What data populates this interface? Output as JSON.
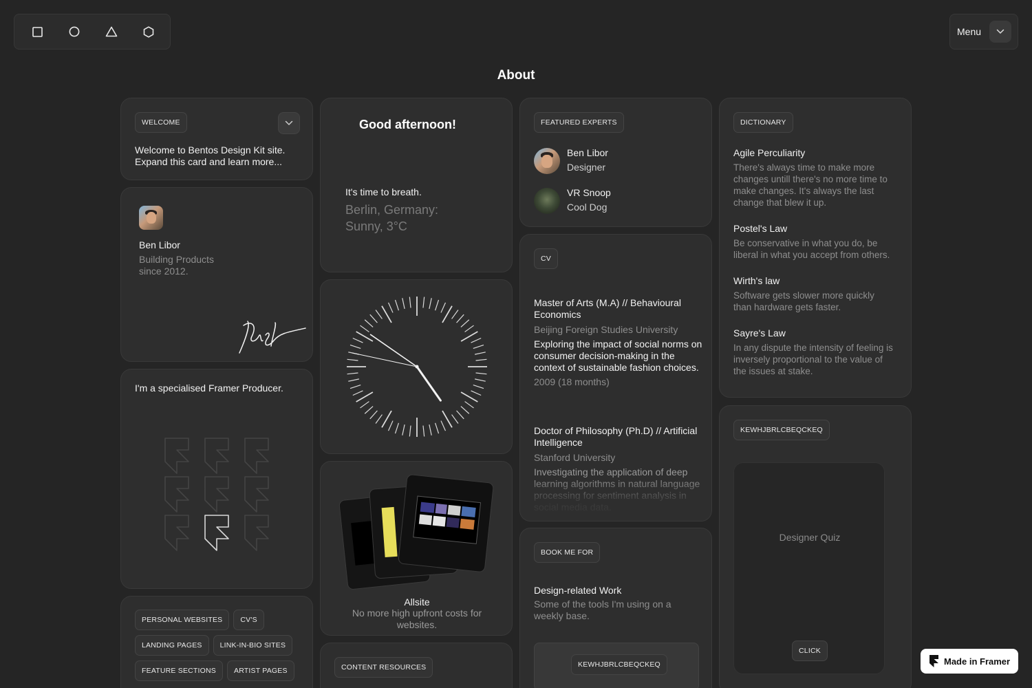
{
  "topbar": {
    "shapes": [
      "square-icon",
      "circle-icon",
      "triangle-icon",
      "hexagon-icon"
    ],
    "menu_label": "Menu"
  },
  "page": {
    "title": "About"
  },
  "welcome": {
    "tag": "WELCOME",
    "text": "Welcome to Bentos Design Kit site. Expand this card and learn more..."
  },
  "profile": {
    "name": "Ben Libor",
    "subtitle": "Building Products since 2012."
  },
  "greeting": {
    "title": "Good afternoon!",
    "line": "It's time to breath.",
    "weather": "Berlin, Germany: Sunny, 3°C"
  },
  "clock": {
    "hour": 4,
    "minute": 50,
    "second": 47
  },
  "experts": {
    "tag": "FEATURED EXPERTS",
    "items": [
      {
        "name": "Ben Libor",
        "role": "Designer"
      },
      {
        "name": "VR Snoop",
        "role": "Cool Dog"
      }
    ]
  },
  "dictionary": {
    "tag": "DICTIONARY",
    "entries": [
      {
        "term": "Agile Perculiarity",
        "definition": "There's always time to make more changes untill there's no more time to make changes. It's always the last change that blew it up."
      },
      {
        "term": "Postel's Law",
        "definition": "Be conservative in what you do, be liberal in what you accept from others."
      },
      {
        "term": "Wirth's law",
        "definition": "Software gets slower more quickly than hardware gets faster."
      },
      {
        "term": "Sayre's Law",
        "definition": "In any dispute the intensity of feeling is inversely proportional to the value of the issues at stake."
      }
    ]
  },
  "producer": {
    "text": "I'm a specialised Framer Producer."
  },
  "cv": {
    "tag": "CV",
    "items": [
      {
        "degree": "Master of Arts (M.A) // Behavioural Economics",
        "school": "Beijing Foreign Studies University",
        "description": "Exploring the impact of social norms on consumer decision-making in the context of sustainable fashion choices.",
        "period": "2009 (18 months)"
      },
      {
        "degree": "Doctor of Philosophy (Ph.D) // Artificial Intelligence",
        "school": "Stanford University",
        "description": "Investigating the application of deep learning algorithms in natural language processing for sentiment analysis in social media data."
      }
    ]
  },
  "allsite": {
    "title": "Allsite",
    "subtitle": "No more high upfront costs for websites."
  },
  "quiz": {
    "tag": "KEWHJBRLCBEQCKEQ",
    "title": "Designer Quiz",
    "button": "CLICK"
  },
  "book": {
    "tag": "BOOK ME FOR",
    "title": "Design-related Work",
    "subtitle": "Some of the tools I'm using on a weekly base.",
    "inner_tag": "KEWHJBRLCBEQCKEQ"
  },
  "services": {
    "rows": [
      [
        "PERSONAL WEBSITES",
        "CV'S"
      ],
      [
        "LANDING PAGES",
        "LINK-IN-BIO SITES"
      ],
      [
        "FEATURE SECTIONS",
        "ARTIST PAGES"
      ]
    ]
  },
  "content_resources": {
    "tag": "CONTENT RESOURCES"
  },
  "badge": {
    "label": "Made in Framer"
  }
}
